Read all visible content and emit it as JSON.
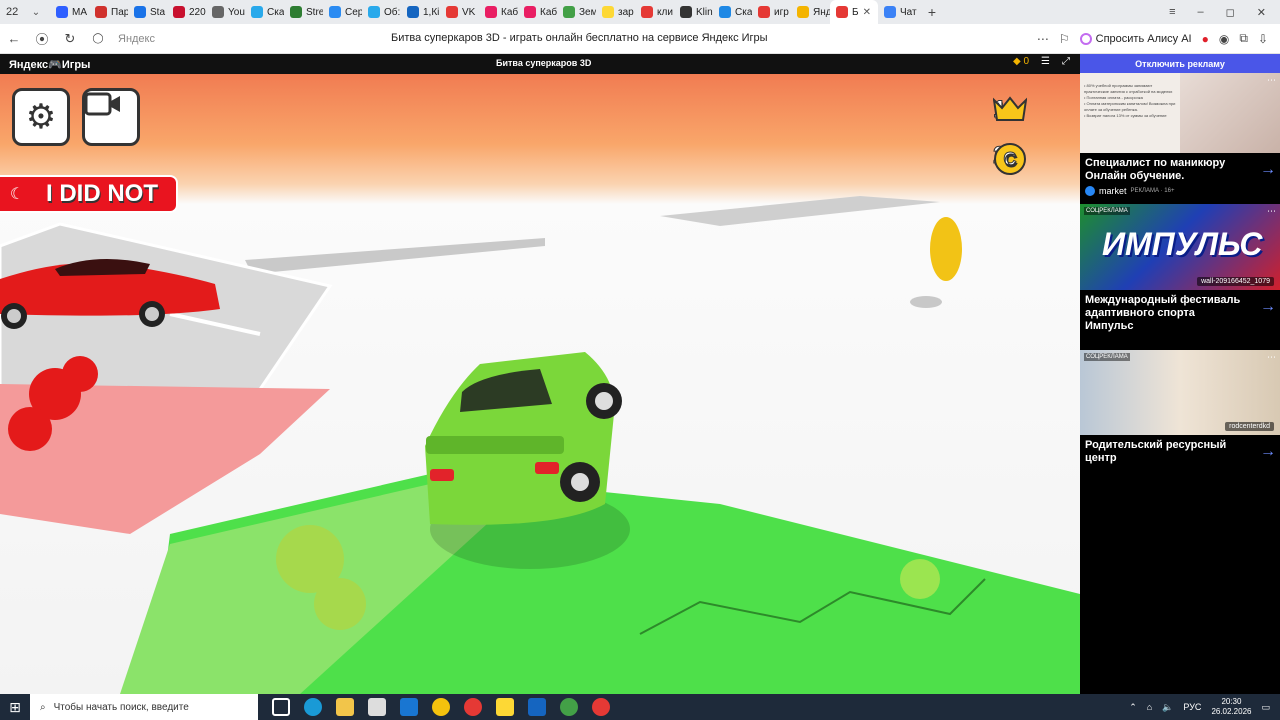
{
  "browser": {
    "tab_count": "22",
    "tabs": [
      {
        "label": "МА",
        "color": "#2f5fff"
      },
      {
        "label": "Пар",
        "color": "#d0312d"
      },
      {
        "label": "Sta",
        "color": "#1a73e8"
      },
      {
        "label": "220",
        "color": "#c8102e"
      },
      {
        "label": "You",
        "color": "#666"
      },
      {
        "label": "Ска",
        "color": "#29a9eb"
      },
      {
        "label": "Stre",
        "color": "#2e7d32"
      },
      {
        "label": "Сер",
        "color": "#2a8bf2"
      },
      {
        "label": "Об:",
        "color": "#29a9eb"
      },
      {
        "label": "1,Кі",
        "color": "#1565c0"
      },
      {
        "label": "VK",
        "color": "#e53935"
      },
      {
        "label": "Каб",
        "color": "#e91e63"
      },
      {
        "label": "Каб",
        "color": "#e91e63"
      },
      {
        "label": "Зем",
        "color": "#43a047"
      },
      {
        "label": "зар",
        "color": "#fdd835"
      },
      {
        "label": "кли",
        "color": "#e53935"
      },
      {
        "label": "Klin",
        "color": "#333"
      },
      {
        "label": "Ска",
        "color": "#1e88e5"
      },
      {
        "label": "игр",
        "color": "#e53935"
      },
      {
        "label": "Янд",
        "color": "#f4b400"
      },
      {
        "label": "Б",
        "color": "#e53935",
        "active": true
      },
      {
        "label": "Чат",
        "color": "#3b82f6"
      }
    ],
    "domain": "Яндекс",
    "page_title": "Битва суперкаров 3D - играть онлайн бесплатно на сервисе Яндекс Игры",
    "alice_label": "Спросить Алису AI"
  },
  "yandex_header": {
    "logo": "Яндекс🎮Игры",
    "game_title": "Битва суперкаров 3D",
    "coins": "0"
  },
  "game": {
    "crowns": "1",
    "coins": "2",
    "player_name": "I DID NOT",
    "colors": {
      "player_green": "#6fdc3a",
      "enemy_red": "#ea1a1a",
      "crown_yellow": "#f8c51a"
    }
  },
  "ads": {
    "disable_label": "Отключить рекламу",
    "items": [
      {
        "title": "Специалист по маникюру Онлайн обучение.",
        "source": "market",
        "label": "РЕКЛАМА · 16+",
        "bullets": [
          "• 80% учебной программы занимают практические занятия с отработкой на моделях",
          "• Поэтапная оплата - рассрочка",
          "• Оплата материнским капиталом! Возможна при оплате за обучение ребенка.",
          "• Возврат налога 13% от суммы за обучение"
        ]
      },
      {
        "title": "Международный фестиваль адаптивного спорта Импульс",
        "tag": "СОЦРЕКЛАМА",
        "banner": "ИМПУЛЬС",
        "handle": "wall-209166452_1079"
      },
      {
        "title": "Родительский ресурсный центр",
        "tag": "СОЦРЕКЛАМА",
        "handle": "rodcenterdkd"
      }
    ]
  },
  "taskbar": {
    "search_placeholder": "Чтобы начать поиск, введите",
    "lang": "РУС",
    "time": "20:30",
    "date": "26.02.2026"
  }
}
